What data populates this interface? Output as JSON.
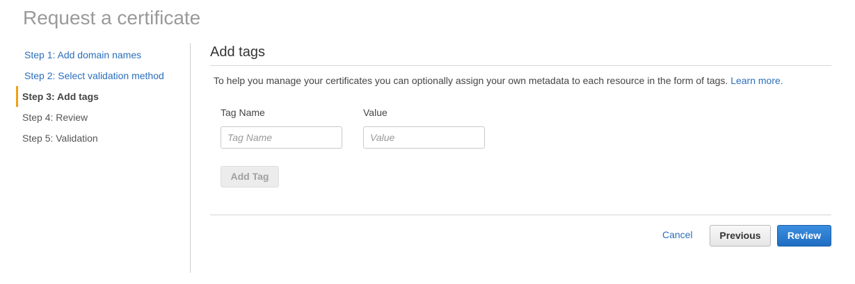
{
  "page": {
    "title": "Request a certificate"
  },
  "steps": [
    {
      "label": "Step 1: Add domain names",
      "state": "completed"
    },
    {
      "label": "Step 2: Select validation method",
      "state": "completed"
    },
    {
      "label": "Step 3: Add tags",
      "state": "current"
    },
    {
      "label": "Step 4: Review",
      "state": "upcoming"
    },
    {
      "label": "Step 5: Validation",
      "state": "upcoming"
    }
  ],
  "section": {
    "title": "Add tags",
    "description": "To help you manage your certificates you can optionally assign your own metadata to each resource in the form of tags.",
    "learn_more": "Learn more."
  },
  "tags": {
    "name_label": "Tag Name",
    "value_label": "Value",
    "name_placeholder": "Tag Name",
    "value_placeholder": "Value",
    "name_value": "",
    "value_value": "",
    "add_button": "Add Tag"
  },
  "footer": {
    "cancel": "Cancel",
    "previous": "Previous",
    "review": "Review"
  },
  "colors": {
    "link": "#2a6ebb",
    "current_step_marker": "#f0a015",
    "primary_button": "#1f6dc2"
  }
}
